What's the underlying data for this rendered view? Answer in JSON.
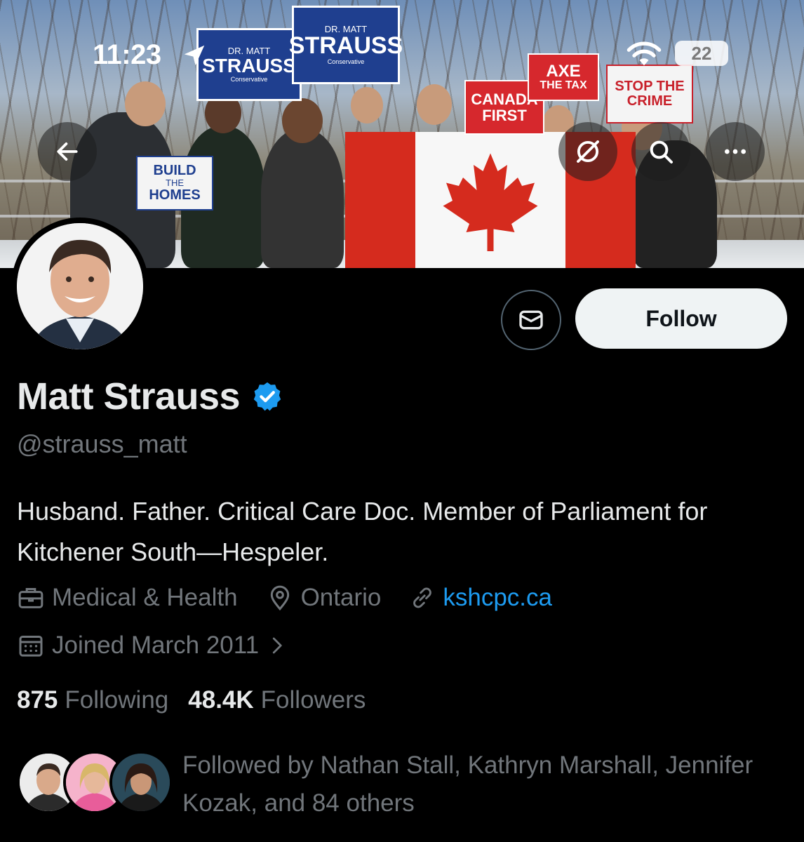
{
  "status_bar": {
    "time": "11:23",
    "battery": "22"
  },
  "banner": {
    "signs": {
      "strauss_left": {
        "line1": "DR. MATT",
        "line2": "STRAUSS",
        "party": "Conservative"
      },
      "strauss_right": {
        "line1": "DR. MATT",
        "line2": "STRAUSS",
        "party": "Conservative"
      },
      "build": {
        "line1": "BUILD",
        "line2": "THE",
        "line3": "HOMES"
      },
      "canada": {
        "line1": "CANADA",
        "line2": "FIRST"
      },
      "axe": {
        "line1": "AXE",
        "line2": "THE TAX"
      },
      "stop": {
        "line1": "STOP THE",
        "line2": "CRIME"
      }
    }
  },
  "actions": {
    "follow_label": "Follow"
  },
  "profile": {
    "name": "Matt Strauss",
    "handle": "@strauss_matt",
    "bio": "Husband. Father. Critical Care Doc. Member of Parliament for Kitchener South—Hespeler.",
    "category": "Medical & Health",
    "location": "Ontario",
    "website": "kshcpc.ca",
    "joined": "Joined March 2011",
    "following_count": "875",
    "following_label": "Following",
    "followers_count": "48.4K",
    "followers_label": "Followers",
    "followed_by": "Followed by Nathan Stall, Kathryn Marshall, Jennifer Kozak, and 84 others"
  },
  "colors": {
    "accent": "#1d9bf0",
    "muted": "#71767b",
    "text": "#e7e9ea",
    "background": "#000000"
  }
}
